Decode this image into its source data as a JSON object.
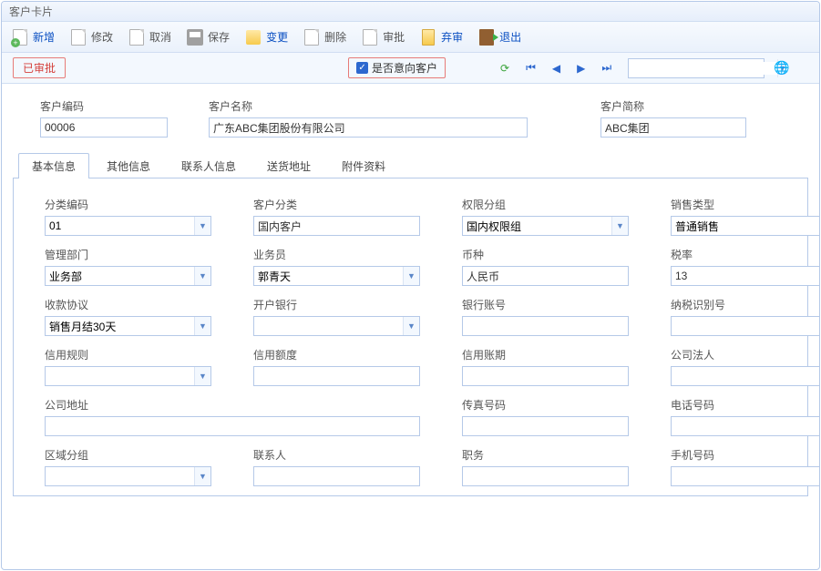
{
  "window": {
    "title": "客户卡片"
  },
  "toolbar": {
    "new": "新增",
    "edit": "修改",
    "cancel": "取消",
    "save": "保存",
    "change": "变更",
    "delete": "删除",
    "approve": "审批",
    "discard": "弃审",
    "exit": "退出"
  },
  "statusrow": {
    "approved_label": "已审批",
    "prospect_label": "是否意向客户",
    "prospect_checked": true,
    "search_value": ""
  },
  "header": {
    "code_label": "客户编码",
    "code_value": "00006",
    "name_label": "客户名称",
    "name_value": "广东ABC集团股份有限公司",
    "short_label": "客户简称",
    "short_value": "ABC集团"
  },
  "tabs": [
    "基本信息",
    "其他信息",
    "联系人信息",
    "送货地址",
    "附件资料"
  ],
  "active_tab": 0,
  "basic": {
    "class_code": {
      "label": "分类编码",
      "value": "01"
    },
    "customer_class": {
      "label": "客户分类",
      "value": "国内客户"
    },
    "perm_group": {
      "label": "权限分组",
      "value": "国内权限组"
    },
    "sale_type": {
      "label": "销售类型",
      "value": "普通销售"
    },
    "mgmt_dept": {
      "label": "管理部门",
      "value": "业务部"
    },
    "salesman": {
      "label": "业务员",
      "value": "郭青天"
    },
    "currency": {
      "label": "币种",
      "value": "人民币"
    },
    "tax_rate": {
      "label": "税率",
      "value": "13"
    },
    "pay_agree": {
      "label": "收款协议",
      "value": "销售月结30天"
    },
    "bank": {
      "label": "开户银行",
      "value": ""
    },
    "bank_acct": {
      "label": "银行账号",
      "value": ""
    },
    "tax_no": {
      "label": "纳税识别号",
      "value": ""
    },
    "credit_rule": {
      "label": "信用规则",
      "value": ""
    },
    "credit_amt": {
      "label": "信用额度",
      "value": ""
    },
    "credit_period": {
      "label": "信用账期",
      "value": ""
    },
    "legal_person": {
      "label": "公司法人",
      "value": ""
    },
    "company_addr": {
      "label": "公司地址",
      "value": ""
    },
    "fax": {
      "label": "传真号码",
      "value": ""
    },
    "phone": {
      "label": "电话号码",
      "value": ""
    },
    "region_group": {
      "label": "区域分组",
      "value": ""
    },
    "contact": {
      "label": "联系人",
      "value": ""
    },
    "position": {
      "label": "职务",
      "value": ""
    },
    "mobile": {
      "label": "手机号码",
      "value": ""
    }
  }
}
